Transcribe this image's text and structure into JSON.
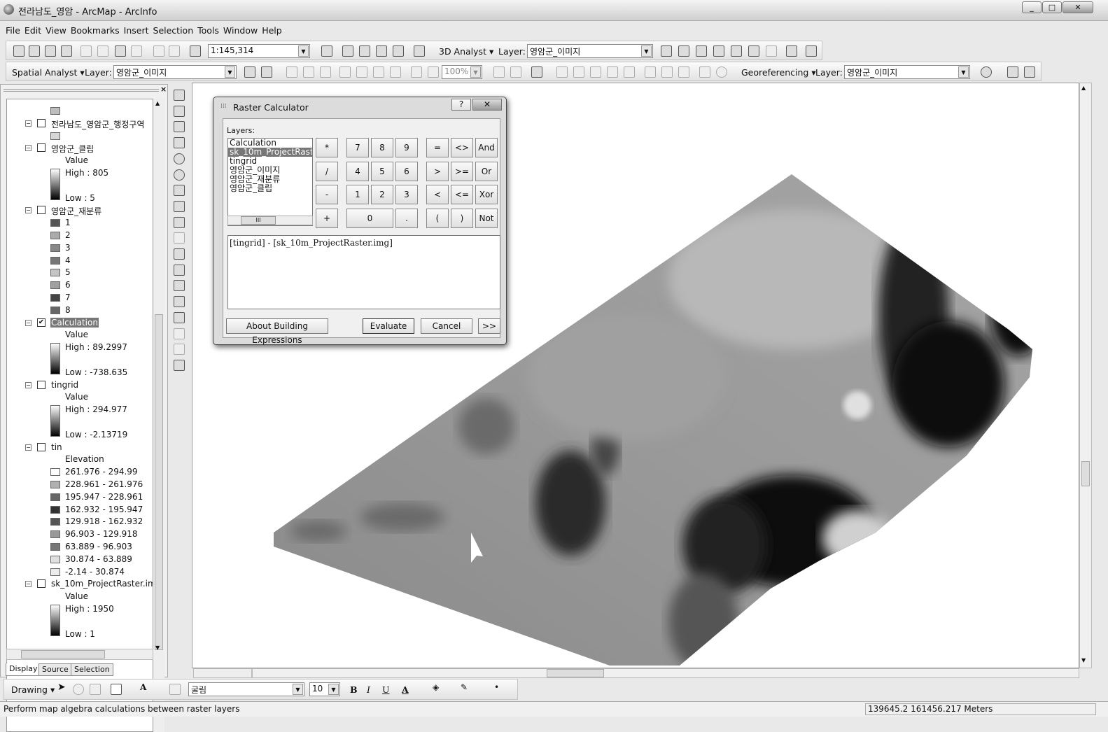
{
  "window": {
    "title": "전라남도_영암 - ArcMap - ArcInfo"
  },
  "menu": [
    "File",
    "Edit",
    "View",
    "Bookmarks",
    "Insert",
    "Selection",
    "Tools",
    "Window",
    "Help"
  ],
  "toolbar1": {
    "scale": "1:145,314",
    "analyst3d": "3D Analyst ▾",
    "layer_label": "Layer:",
    "layer_value": "영암군_이미지"
  },
  "toolbar2": {
    "spatial_analyst": "Spatial Analyst ▾",
    "layer_label": "Layer:",
    "layer_value": "영암군_이미지",
    "zoom_pct": "100%",
    "georef": "Georeferencing ▾",
    "georef_layer_label": "Layer:",
    "georef_layer_value": "영암군_이미지"
  },
  "toc": {
    "rows": [
      {
        "t": "sw",
        "c": "#bdbdbd"
      },
      {
        "t": "layer",
        "label": "전라남도_영암군_행정구역",
        "checked": false
      },
      {
        "t": "sw",
        "c": "#d6d6d6"
      },
      {
        "t": "layer",
        "label": "영암군_클립",
        "checked": false
      },
      {
        "t": "text",
        "label": "Value"
      },
      {
        "t": "grad",
        "label": "High : 805"
      },
      {
        "t": "blank"
      },
      {
        "t": "text2",
        "label": "Low : 5"
      },
      {
        "t": "layer",
        "label": "영암군_재분류",
        "checked": false
      },
      {
        "t": "cls",
        "label": "1",
        "c": "#555"
      },
      {
        "t": "cls",
        "label": "2",
        "c": "#aaa"
      },
      {
        "t": "cls",
        "label": "3",
        "c": "#888"
      },
      {
        "t": "cls",
        "label": "4",
        "c": "#777"
      },
      {
        "t": "cls",
        "label": "5",
        "c": "#c4c4c4"
      },
      {
        "t": "cls",
        "label": "6",
        "c": "#a0a0a0"
      },
      {
        "t": "cls",
        "label": "7",
        "c": "#444"
      },
      {
        "t": "cls",
        "label": "8",
        "c": "#666"
      },
      {
        "t": "layer",
        "label": "Calculation",
        "checked": true,
        "selected": true
      },
      {
        "t": "text",
        "label": "Value"
      },
      {
        "t": "grad",
        "label": "High : 89.2997"
      },
      {
        "t": "blank"
      },
      {
        "t": "text2",
        "label": "Low : -738.635"
      },
      {
        "t": "layer",
        "label": "tingrid",
        "checked": false
      },
      {
        "t": "text",
        "label": "Value"
      },
      {
        "t": "grad",
        "label": "High : 294.977"
      },
      {
        "t": "blank"
      },
      {
        "t": "text2",
        "label": "Low : -2.13719"
      },
      {
        "t": "layer",
        "label": "tin",
        "checked": false
      },
      {
        "t": "text",
        "label": "Elevation"
      },
      {
        "t": "cls",
        "label": "261.976 - 294.99",
        "c": "#ffffff"
      },
      {
        "t": "cls",
        "label": "228.961 - 261.976",
        "c": "#b0b0b0"
      },
      {
        "t": "cls",
        "label": "195.947 - 228.961",
        "c": "#666"
      },
      {
        "t": "cls",
        "label": "162.932 - 195.947",
        "c": "#333"
      },
      {
        "t": "cls",
        "label": "129.918 - 162.932",
        "c": "#555"
      },
      {
        "t": "cls",
        "label": "96.903 - 129.918",
        "c": "#999"
      },
      {
        "t": "cls",
        "label": "63.889 - 96.903",
        "c": "#777"
      },
      {
        "t": "cls",
        "label": "30.874 - 63.889",
        "c": "#e0e0e0"
      },
      {
        "t": "cls",
        "label": "-2.14 - 30.874",
        "c": "#ececec"
      },
      {
        "t": "layer",
        "label": "sk_10m_ProjectRaster.img",
        "checked": false
      },
      {
        "t": "text",
        "label": "Value"
      },
      {
        "t": "grad",
        "label": "High : 1950"
      },
      {
        "t": "blank"
      },
      {
        "t": "text2",
        "label": "Low : 1"
      }
    ],
    "tabs": [
      "Display",
      "Source",
      "Selection"
    ]
  },
  "dialog": {
    "title": "Raster Calculator",
    "layers_label": "Layers:",
    "layers": [
      "Calculation",
      "sk_10m_ProjectRaster.img",
      "tingrid",
      "영암군_이미지",
      "영암군_재분류",
      "영암군_클립"
    ],
    "selected_layer": "sk_10m_ProjectRaster.img",
    "keys": [
      [
        "*",
        "7",
        "8",
        "9",
        "=",
        "<>",
        "And"
      ],
      [
        "/",
        "4",
        "5",
        "6",
        ">",
        ">=",
        "Or"
      ],
      [
        "-",
        "1",
        "2",
        "3",
        "<",
        "<=",
        "Xor"
      ],
      [
        "+",
        "0",
        ".",
        "(",
        ")",
        "Not"
      ]
    ],
    "expression": "[tingrid] - [sk_10m_ProjectRaster.img]",
    "about": "About Building Expressions",
    "evaluate": "Evaluate",
    "cancel": "Cancel",
    "more": ">>",
    "scroll_thumb": "III"
  },
  "drawing": {
    "label": "Drawing ▾",
    "font": "굴림",
    "size": "10",
    "bold": "B",
    "italic": "I",
    "underline": "U",
    "font_color": "A"
  },
  "status": {
    "message": "Perform map algebra calculations between raster layers",
    "coords": "139645.2  161456.217 Meters"
  }
}
